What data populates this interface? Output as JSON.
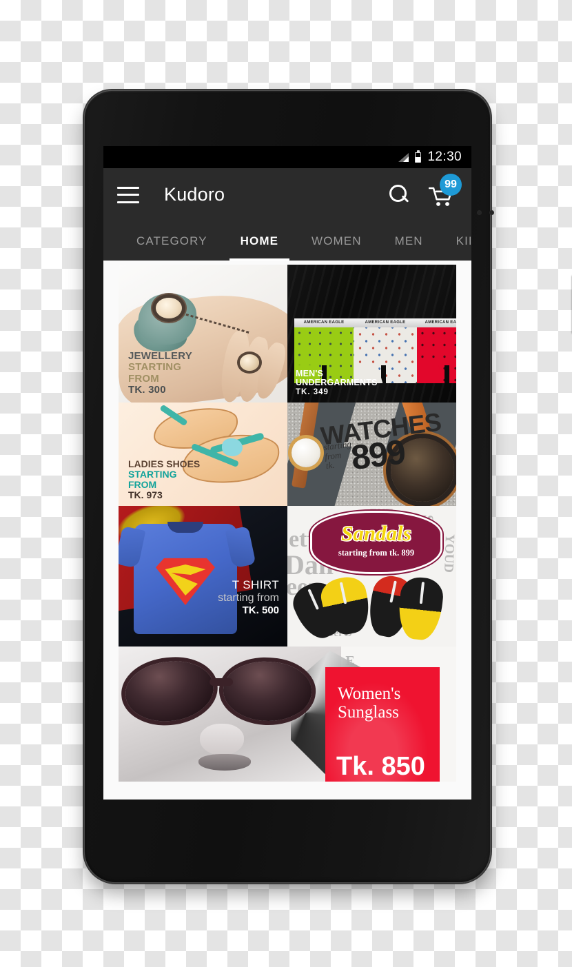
{
  "status_bar": {
    "time": "12:30",
    "signal_icon": "signal-bars-icon",
    "battery_icon": "battery-icon"
  },
  "app_bar": {
    "menu_icon": "hamburger-menu-icon",
    "title": "Kudoro",
    "search_icon": "search-icon",
    "cart_icon": "shopping-cart-icon",
    "cart_badge": "99",
    "badge_color": "#1e9ad6",
    "background": "#2b2b2b"
  },
  "tabs": {
    "items": [
      {
        "label": "CATEGORY",
        "active": false
      },
      {
        "label": "HOME",
        "active": true
      },
      {
        "label": "WOMEN",
        "active": false
      },
      {
        "label": "MEN",
        "active": false
      },
      {
        "label": "KII",
        "active": false
      }
    ]
  },
  "grid": {
    "jewellery": {
      "line1": "JEWELLERY",
      "line2": "STARTING",
      "line3": "FROM",
      "line4": "TK. 300"
    },
    "undergarments": {
      "line1": "MEN'S",
      "line2": "UNDERGARMENTS",
      "price": "TK.  349",
      "band_text": "AMERICAN EAGLE"
    },
    "ladies_shoes": {
      "line1": "LADIES SHOES",
      "line2": "STARTING",
      "line3": "FROM",
      "line4": "TK. 973"
    },
    "watches": {
      "line1": "WATCHES",
      "line2": "starting",
      "line3": "from",
      "line4": "tk.",
      "price": "899"
    },
    "tshirt": {
      "line1": "T SHIRT",
      "line2": "starting from",
      "line3": "TK. 500"
    },
    "sandals": {
      "line1": "Sandals",
      "line2": "starting from tk. 899"
    },
    "sunglass": {
      "line1": "Women's",
      "line2": "Sunglass",
      "price": "Tk. 850",
      "card_color": "#ef1330"
    }
  }
}
